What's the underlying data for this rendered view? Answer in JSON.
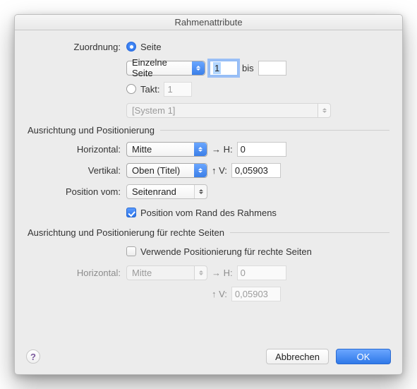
{
  "title": "Rahmenattribute",
  "assignment": {
    "label": "Zuordnung:",
    "page_radio_label": "Seite",
    "range_select": "Einzelne Seite",
    "range_from": "1",
    "range_to_label": "bis",
    "range_to": "",
    "measure_radio_label": "Takt:",
    "measure_value": "1",
    "system_select": "[System 1]"
  },
  "section1_title": "Ausrichtung und Positionierung",
  "align": {
    "h_label": "Horizontal:",
    "h_select": "Mitte",
    "h_arrow": "→ H:",
    "h_value": "0",
    "v_label": "Vertikal:",
    "v_select": "Oben (Titel)",
    "v_arrow": "↑ V:",
    "v_value": "0,05903",
    "pos_from_label": "Position vom:",
    "pos_from_select": "Seitenrand",
    "edge_checkbox_label": "Position vom Rand des Rahmens"
  },
  "section2_title": "Ausrichtung und Positionierung für rechte Seiten",
  "right": {
    "use_checkbox_label": "Verwende Positionierung für rechte Seiten",
    "h_label": "Horizontal:",
    "h_select": "Mitte",
    "h_arrow": "→ H:",
    "h_value": "0",
    "v_arrow": "↑ V:",
    "v_value": "0,05903"
  },
  "buttons": {
    "cancel": "Abbrechen",
    "ok": "OK",
    "help": "?"
  }
}
